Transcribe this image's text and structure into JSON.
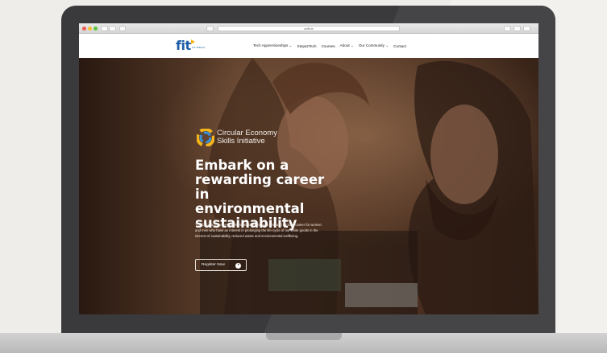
{
  "browser": {
    "url": "cefit.ie"
  },
  "header": {
    "logo_text": "fit",
    "logo_subtext": "FIT Skillsnet",
    "menu": [
      {
        "label": "Tech Apprenticeships ⌄"
      },
      {
        "label": "Steps2Tech"
      },
      {
        "label": "Courses"
      },
      {
        "label": "About ⌄"
      },
      {
        "label": "Our Community ⌄"
      },
      {
        "label": "Contact"
      }
    ]
  },
  "hero": {
    "badge_text": "Circular Economy\nSkills Initiative",
    "headline": "Embark on a\nrewarding career in\nenvironmental\nsustainability",
    "intro": "The Circular Economy Skills Initiative opens up a new and exciting career for women and men who have an interest in prolonging the life-cycle of our white goods in the interest of sustainability, reduced waste and environmental wellbeing.",
    "cta_label": "Register Now"
  },
  "colors": {
    "brand_blue": "#1f5fa8",
    "brand_yellow": "#f4b41a",
    "page_background": "#efedea",
    "laptop_frame": "#3a3a3c"
  },
  "icons": [
    "browser-close-dot",
    "browser-minimize-dot",
    "browser-zoom-dot",
    "circular-economy-logo-icon",
    "play-circle-icon"
  ]
}
